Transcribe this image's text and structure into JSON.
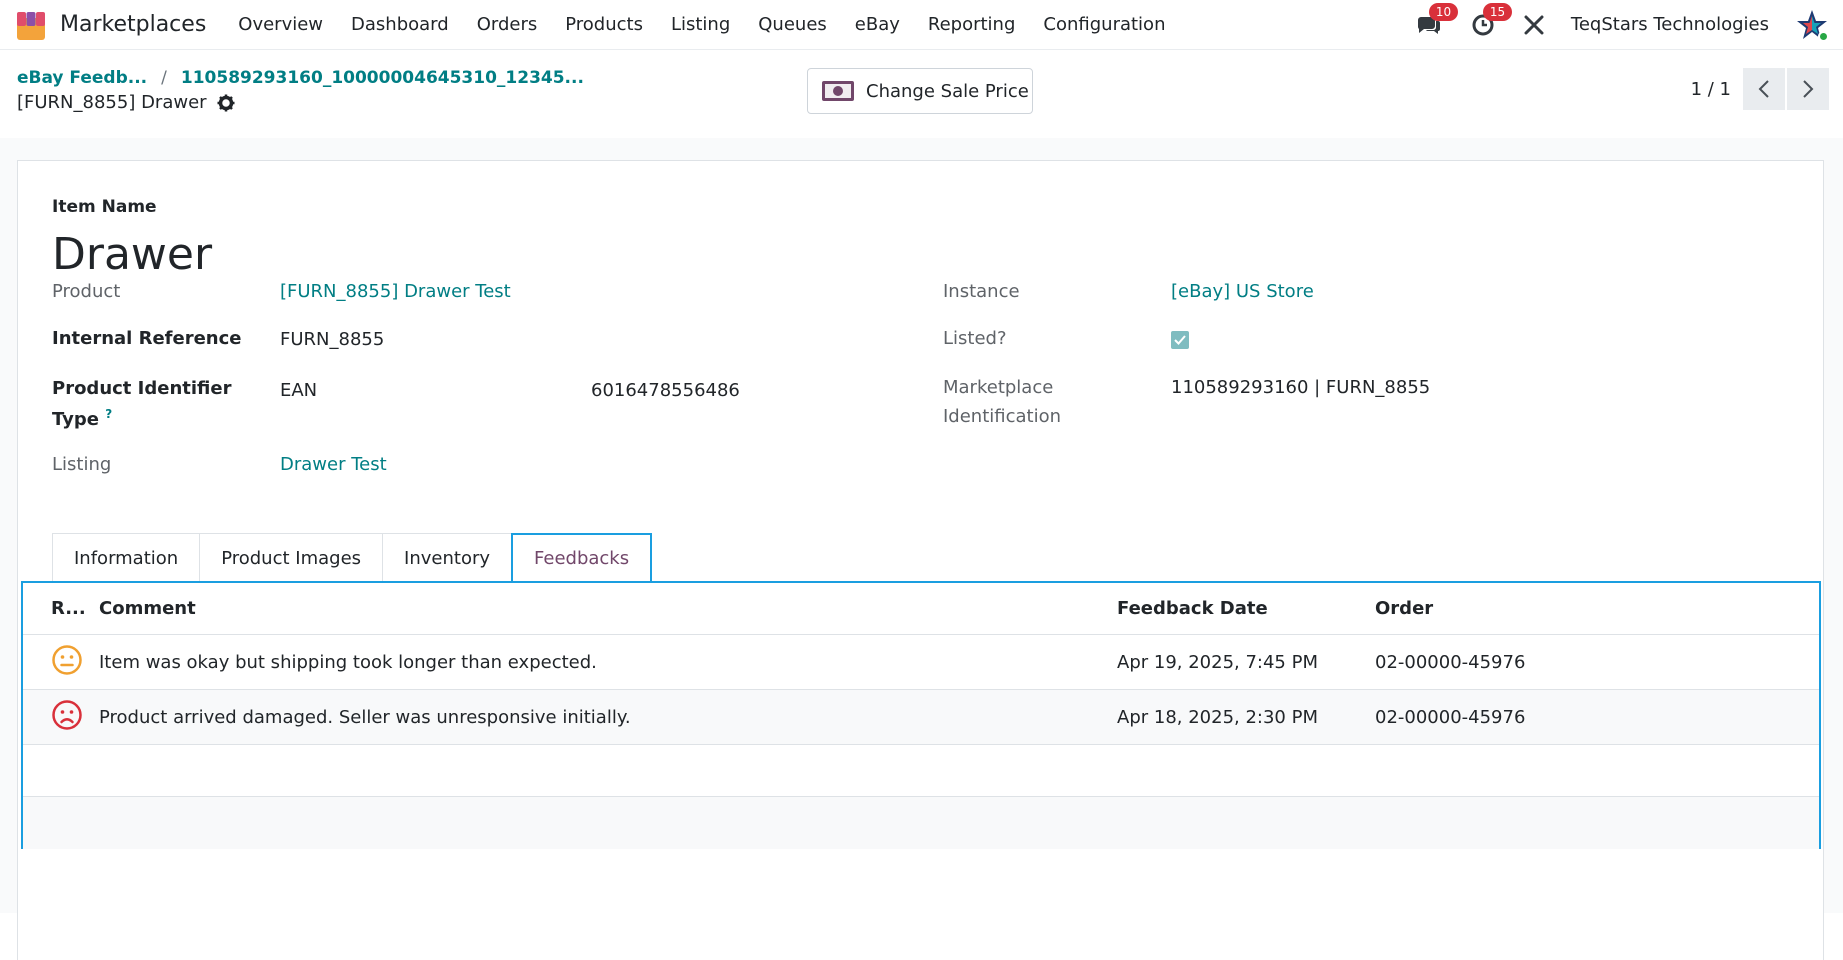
{
  "app": {
    "name": "Marketplaces"
  },
  "nav": {
    "items": [
      "Overview",
      "Dashboard",
      "Orders",
      "Products",
      "Listing",
      "Queues",
      "eBay",
      "Reporting",
      "Configuration"
    ],
    "messages_count": "10",
    "activities_count": "15",
    "company": "TeqStars Technologies"
  },
  "breadcrumb": {
    "parent": "eBay Feedb...",
    "current": "110589293160_10000004645310_12345...",
    "record": "[FURN_8855] Drawer"
  },
  "actions": {
    "change_sale_price": "Change Sale Price"
  },
  "pager": {
    "value": "1 / 1"
  },
  "form": {
    "item_name_label": "Item Name",
    "item_name": "Drawer",
    "product_label": "Product",
    "product": "[FURN_8855] Drawer Test",
    "internal_ref_label": "Internal Reference",
    "internal_ref": "FURN_8855",
    "pid_type_label_1": "Product Identifier",
    "pid_type_label_2": "Type",
    "help": "?",
    "pid_type": "EAN",
    "pid_value": "6016478556486",
    "listing_label": "Listing",
    "listing": "Drawer Test",
    "instance_label": "Instance",
    "instance": "[eBay] US Store",
    "listed_label": "Listed?",
    "listed": true,
    "mp_ident_label_1": "Marketplace",
    "mp_ident_label_2": "Identification",
    "mp_ident": "110589293160 | FURN_8855"
  },
  "tabs": [
    "Information",
    "Product Images",
    "Inventory",
    "Feedbacks"
  ],
  "feedbacks": {
    "headers": {
      "rating": "R...",
      "comment": "Comment",
      "date": "Feedback Date",
      "order": "Order"
    },
    "rows": [
      {
        "rating": "neutral",
        "comment": "Item was okay but shipping took longer than expected.",
        "date": "Apr 19, 2025, 7:45 PM",
        "order": "02-00000-45976"
      },
      {
        "rating": "negative",
        "comment": "Product arrived damaged. Seller was unresponsive initially.",
        "date": "Apr 18, 2025, 2:30 PM",
        "order": "02-00000-45976"
      }
    ]
  },
  "colors": {
    "accent": "#017e84",
    "brand": "#71476a",
    "focus": "#1a9ee0",
    "neutral": "#f0a030",
    "negative": "#d9303a"
  }
}
